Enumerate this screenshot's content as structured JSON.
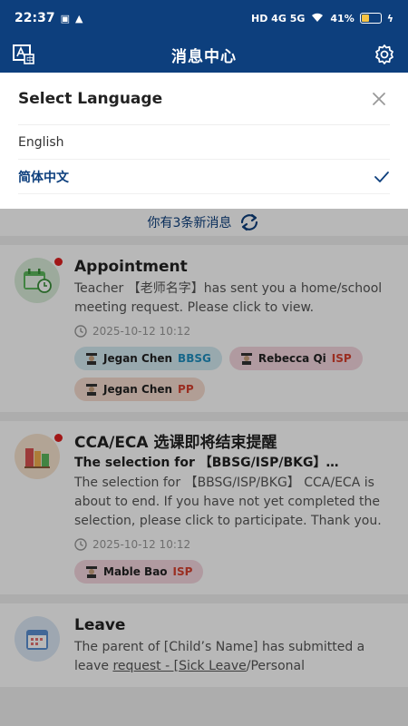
{
  "status": {
    "time": "22:37",
    "network": "HD 4G 5G",
    "battery_percent": "41%",
    "battery_level": 0.41
  },
  "appbar": {
    "title": "消息中心"
  },
  "language_sheet": {
    "title": "Select Language",
    "options": [
      {
        "label": "English",
        "selected": false
      },
      {
        "label": "简体中文",
        "selected": true
      }
    ]
  },
  "new_messages": {
    "text": "你有3条新消息"
  },
  "messages": [
    {
      "title": "Appointment",
      "body": "Teacher 【老师名字】has sent you a home/school meeting request. Please click to view.",
      "time": "2025-10-12 10:12",
      "tags": [
        {
          "name": "Jegan Chen",
          "school": "BBSG"
        },
        {
          "name": "Rebecca Qi",
          "school": "ISP"
        },
        {
          "name": "Jegan Chen",
          "school": "PP"
        }
      ]
    },
    {
      "title": "CCA/ECA 选课即将结束提醒",
      "subtitle": "The selection for 【BBSG/ISP/BKG】…",
      "body": "The selection for 【BBSG/ISP/BKG】 CCA/ECA is about to end. If you have not yet completed the selection, please click to participate. Thank you.",
      "time": "2025-10-12 10:12",
      "tags": [
        {
          "name": "Mable Bao",
          "school": "ISP"
        }
      ]
    },
    {
      "title": "Leave",
      "body_part1": "The parent of [Child’s Name] has submitted a leave ",
      "body_link": "request - [Sick Leave",
      "body_part2": "/Personal"
    }
  ]
}
